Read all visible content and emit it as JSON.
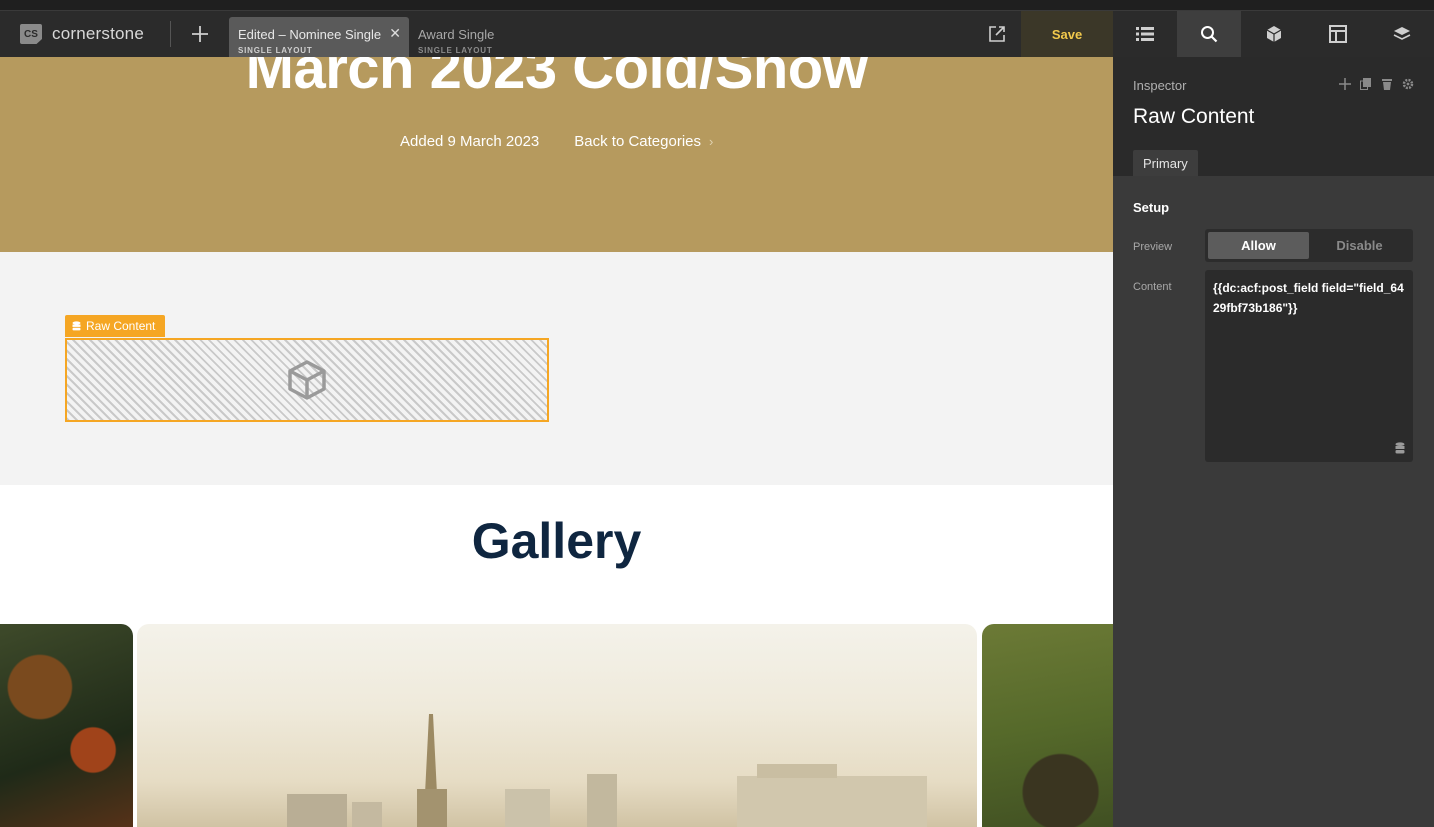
{
  "app": {
    "logo_badge": "CS",
    "logo_text": "cornerstone"
  },
  "tabs": [
    {
      "title": "Edited – Nominee Single",
      "subtitle": "SINGLE LAYOUT",
      "active": true
    },
    {
      "title": "Award Single",
      "subtitle": "SINGLE LAYOUT",
      "active": false
    }
  ],
  "toolbar": {
    "save_label": "Save",
    "accent": "#f2c94c"
  },
  "hero": {
    "title": "March 2023 Cold/Snow",
    "added": "Added 9 March 2023",
    "back_link": "Back to Categories",
    "bg": "#b69a5e"
  },
  "element": {
    "label": "Raw Content",
    "accent": "#f5a623"
  },
  "gallery": {
    "title": "Gallery"
  },
  "inspector": {
    "section_label": "Inspector",
    "title": "Raw Content",
    "tab": "Primary",
    "setup_heading": "Setup",
    "preview_label": "Preview",
    "preview_options": [
      "Allow",
      "Disable"
    ],
    "preview_selected": "Allow",
    "content_label": "Content",
    "content_value": "{{dc:acf:post_field field=\"field_6429fbf73b186\"}}"
  },
  "icons": {
    "right_toolbar": [
      "list-icon",
      "search-icon",
      "cube-icon",
      "layout-icon",
      "layers-icon"
    ],
    "inspector_actions": [
      "move-icon",
      "duplicate-icon",
      "delete-icon",
      "settings-icon"
    ]
  }
}
